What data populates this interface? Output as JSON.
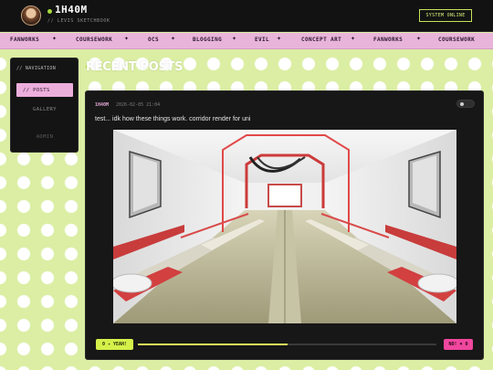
{
  "header": {
    "title": "1H40M",
    "subtitle": "// LEVIS SKETCHBOOK",
    "status_button": "SYSTEM ONLINE"
  },
  "marquee": {
    "items": [
      "FANWORKS",
      "COURSEWORK",
      "OCS",
      "BLOGGING",
      "EVIL",
      "CONCEPT ART",
      "FANWORKS",
      "COURSEWORK"
    ],
    "separator": "✦"
  },
  "sidebar": {
    "heading": "// NAVIGATION",
    "items": [
      {
        "label": "// POSTS",
        "state": "active"
      },
      {
        "label": "GALLERY",
        "state": "normal"
      },
      {
        "label": "ADMIN",
        "state": "dim"
      }
    ]
  },
  "main": {
    "heading": "RECENT POSTS"
  },
  "post": {
    "author": "1H40M",
    "date": "2026-02-05 21:04",
    "caption": "test... idk how these things work. corridor render for uni",
    "image": "3D sci-fi corridor render with white walls and red accent lights",
    "reactions": {
      "yeah_label": "0 ✦ YEAH!",
      "no_label": "NO! ✖ 0",
      "yeah_share": 0.5
    }
  },
  "colors": {
    "accent_green": "#d6f04a",
    "accent_pink": "#e9b4da",
    "accent_magenta": "#f0479e",
    "page_bg": "#dbeea4"
  }
}
